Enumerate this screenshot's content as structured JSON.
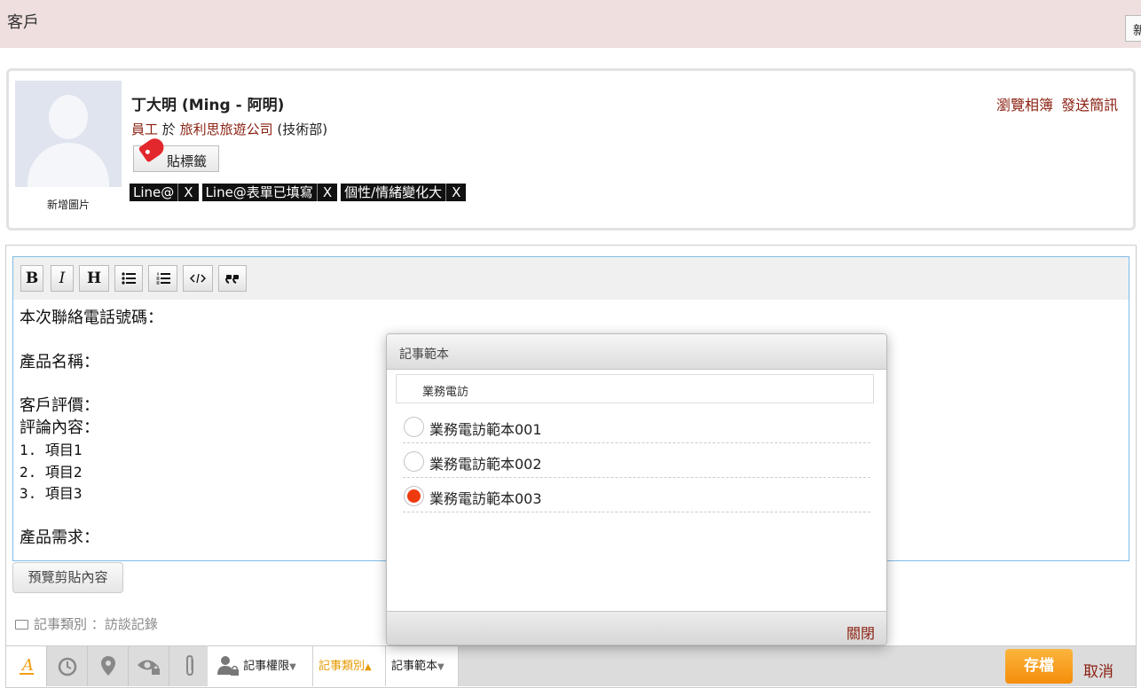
{
  "header": {
    "title": "客戶",
    "new_button": "新"
  },
  "profile": {
    "name": "丁大明 (Ming - 阿明)",
    "role": "員工",
    "at": "於",
    "company": "旅利思旅遊公司",
    "department": "(技術部)",
    "avatar_caption": "新增圖片",
    "tag_button": "貼標籤",
    "tags": [
      "Line@",
      "Line@表單已填寫",
      "個性/情緒變化大"
    ],
    "tag_remove": "X",
    "links": {
      "album": "瀏覽相簿",
      "sms": "發送簡訊"
    }
  },
  "editor": {
    "toolbar": {
      "bold": "B",
      "italic": "I",
      "heading": "H"
    },
    "content": {
      "phone": "本次聯絡電話號碼：",
      "product": "產品名稱：",
      "rating": "客戶評價：",
      "review": "評論內容：",
      "items": [
        "1. 項目1",
        "2. 項目2",
        "3. 項目3"
      ],
      "demand": "產品需求："
    }
  },
  "preview_button": "預覽剪貼內容",
  "category": {
    "label": "記事類別",
    "separator": "：",
    "value": "訪談記錄"
  },
  "bottom_bar": {
    "permission": "記事權限",
    "category": "記事類別",
    "template": "記事範本",
    "save": "存檔",
    "cancel": "取消"
  },
  "modal": {
    "title": "記事範本",
    "search_value": "業務電訪",
    "options": [
      "業務電訪範本001",
      "業務電訪範本002",
      "業務電訪範本003"
    ],
    "selected_index": 2,
    "close": "關閉"
  },
  "colors": {
    "link": "#8a1f0f",
    "accent": "#f5a623",
    "radio_selected": "#ed3b0f",
    "header_bg": "#efdfdf"
  }
}
